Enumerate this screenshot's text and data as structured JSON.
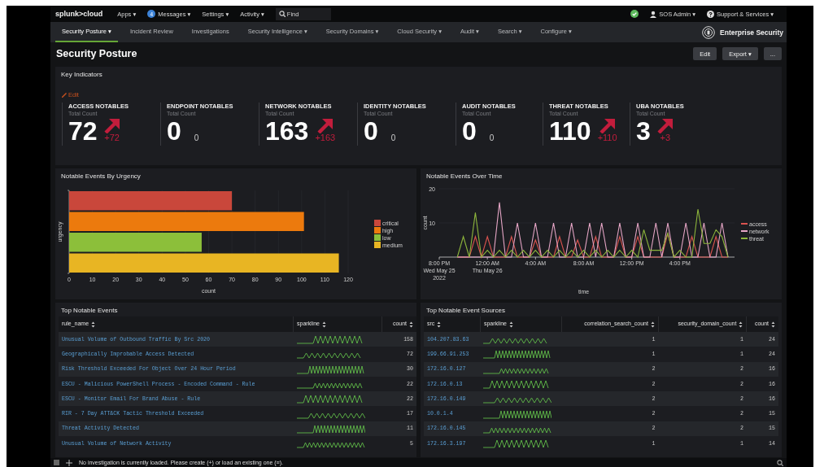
{
  "topbar": {
    "logo": "splunk>cloud",
    "menus": [
      {
        "label": "Apps ▾"
      },
      {
        "label": "Messages ▾",
        "badge": "4"
      },
      {
        "label": "Settings ▾"
      },
      {
        "label": "Activity ▾"
      }
    ],
    "search": {
      "placeholder": "Find"
    },
    "user": "SOS Admin ▾",
    "help": "Support & Services ▾"
  },
  "nav": {
    "tabs": [
      {
        "label": "Security Posture ▾",
        "selected": true
      },
      {
        "label": "Incident Review",
        "selected": false
      },
      {
        "label": "Investigations",
        "selected": false
      },
      {
        "label": "Security Intelligence ▾",
        "selected": false
      },
      {
        "label": "Security Domains ▾",
        "selected": false
      },
      {
        "label": "Cloud Security ▾",
        "selected": false
      },
      {
        "label": "Audit ▾",
        "selected": false
      },
      {
        "label": "Search ▾",
        "selected": false
      },
      {
        "label": "Configure ▾",
        "selected": false
      }
    ],
    "app_name": "Enterprise Security"
  },
  "page": {
    "title": "Security Posture",
    "buttons": [
      {
        "label": "Edit"
      },
      {
        "label": "Export ▾"
      },
      {
        "label": "..."
      }
    ]
  },
  "key_indicators": {
    "title": "Key Indicators",
    "edit_link": "Edit",
    "items": [
      {
        "label": "ACCESS NOTABLES",
        "sublabel": "Total Count",
        "value": "72",
        "delta": "+72",
        "rising": true
      },
      {
        "label": "ENDPOINT NOTABLES",
        "sublabel": "Total Count",
        "value": "0",
        "delta": "0",
        "rising": false
      },
      {
        "label": "NETWORK NOTABLES",
        "sublabel": "Total Count",
        "value": "163",
        "delta": "+163",
        "rising": true
      },
      {
        "label": "IDENTITY NOTABLES",
        "sublabel": "Total Count",
        "value": "0",
        "delta": "0",
        "rising": false
      },
      {
        "label": "AUDIT NOTABLES",
        "sublabel": "Total Count",
        "value": "0",
        "delta": "0",
        "rising": false
      },
      {
        "label": "THREAT NOTABLES",
        "sublabel": "Total Count",
        "value": "110",
        "delta": "+110",
        "rising": true
      },
      {
        "label": "UBA NOTABLES",
        "sublabel": "Total Count",
        "value": "3",
        "delta": "+3",
        "rising": true
      }
    ]
  },
  "urgency_panel": {
    "title": "Notable Events By Urgency",
    "chart_data": {
      "type": "bar",
      "orientation": "horizontal",
      "xlabel": "count",
      "ylabel": "urgency",
      "grid": true,
      "series": [
        {
          "name": "critical",
          "color": "#c9473b",
          "values": [
            70
          ]
        },
        {
          "name": "high",
          "color": "#ec7a0d",
          "values": [
            101
          ]
        },
        {
          "name": "low",
          "color": "#8cbf3a",
          "values": [
            57
          ]
        },
        {
          "name": "medium",
          "color": "#e8b523",
          "values": [
            116
          ]
        }
      ],
      "legend": true,
      "xlim": [
        0,
        120
      ],
      "xticks": [
        {
          "value": 0,
          "label": "0"
        },
        {
          "value": 10,
          "label": "10"
        },
        {
          "value": 20,
          "label": "20"
        },
        {
          "value": 30,
          "label": "30"
        },
        {
          "value": 40,
          "label": "40"
        },
        {
          "value": 50,
          "label": "50"
        },
        {
          "value": 60,
          "label": "60"
        },
        {
          "value": 70,
          "label": "70"
        },
        {
          "value": 80,
          "label": "80"
        },
        {
          "value": 90,
          "label": "90"
        },
        {
          "value": 100,
          "label": "100"
        },
        {
          "value": 110,
          "label": "110"
        },
        {
          "value": 120,
          "label": "120"
        }
      ]
    }
  },
  "time_panel": {
    "title": "Notable Events Over Time",
    "chart_data": {
      "type": "line",
      "xlabel": "time",
      "ylabel": "count",
      "categories": [
        "8:00 PM\nWed May 25\n2022",
        null,
        null,
        null,
        null,
        null,
        null,
        null,
        "12:00 AM\nThu May 26",
        null,
        null,
        null,
        null,
        null,
        null,
        null,
        "4:00 AM",
        null,
        null,
        null,
        null,
        null,
        null,
        null,
        "8:00 AM",
        null,
        null,
        null,
        null,
        null,
        null,
        null,
        "12:00 PM",
        null,
        null,
        null,
        null,
        null,
        null,
        null,
        "4:00 PM",
        null,
        null,
        null,
        null,
        null,
        null,
        null,
        null
      ],
      "series": [
        {
          "name": "access",
          "color": "#d9534f",
          "values": [
            null,
            null,
            null,
            0,
            0,
            0,
            6,
            0,
            6,
            0,
            0,
            0,
            6,
            0,
            0,
            0,
            5,
            0,
            0,
            0,
            6,
            0,
            0,
            5,
            0,
            0,
            6,
            0,
            0,
            0,
            6,
            0,
            0,
            6,
            0,
            0,
            0,
            0,
            7,
            0,
            0,
            0,
            6,
            0,
            0,
            0,
            6,
            0,
            0
          ]
        },
        {
          "name": "network",
          "color": "#e6a6c6",
          "values": [
            null,
            null,
            null,
            0,
            0,
            0,
            0,
            0,
            0,
            0,
            16,
            0,
            0,
            10,
            0,
            0,
            10,
            0,
            0,
            10,
            0,
            0,
            10,
            0,
            0,
            10,
            0,
            10,
            0,
            0,
            10,
            0,
            0,
            10,
            0,
            0,
            10,
            0,
            10,
            0,
            0,
            10,
            0,
            0,
            10,
            0,
            0,
            10,
            0
          ]
        },
        {
          "name": "threat",
          "color": "#8db53c",
          "values": [
            null,
            null,
            null,
            0,
            6,
            0,
            13,
            0,
            2,
            0,
            2,
            0,
            2,
            0,
            2,
            0,
            2,
            0,
            2,
            0,
            2,
            0,
            2,
            0,
            2,
            0,
            2,
            0,
            2,
            0,
            2,
            0,
            2,
            0,
            8,
            2,
            2,
            2,
            7,
            0,
            2,
            0,
            0,
            14,
            4,
            4,
            8,
            6,
            0
          ]
        }
      ],
      "legend": true,
      "ylim": [
        0,
        20
      ],
      "yticks": [
        {
          "value": 10,
          "label": "10"
        },
        {
          "value": 20,
          "label": "20"
        }
      ]
    }
  },
  "top_events": {
    "title": "Top Notable Events",
    "columns": [
      "rule_name",
      "sparkline",
      "count"
    ],
    "rows": [
      {
        "rule_name": "Unusual Volume of Outbound Traffic By Src 2020",
        "count": "158"
      },
      {
        "rule_name": "Geographically Improbable Access Detected",
        "count": "72"
      },
      {
        "rule_name": "Risk Threshold Exceeded For Object Over 24 Hour Period",
        "count": "30"
      },
      {
        "rule_name": "ESCU - Malicious PowerShell Process - Encoded Command - Rule",
        "count": "22"
      },
      {
        "rule_name": "ESCU - Monitor Email For Brand Abuse - Rule",
        "count": "22"
      },
      {
        "rule_name": "RIR - 7 Day ATT&CK Tactic Threshold Exceeded",
        "count": "17"
      },
      {
        "rule_name": "Threat Activity Detected",
        "count": "11"
      },
      {
        "rule_name": "Unusual Volume of Network Activity",
        "count": "5"
      }
    ]
  },
  "top_sources": {
    "title": "Top Notable Event Sources",
    "columns": [
      "src",
      "sparkline",
      "correlation_search_count",
      "security_domain_count",
      "count"
    ],
    "rows": [
      {
        "src": "104.207.83.63",
        "correlation_search_count": "1",
        "security_domain_count": "1",
        "count": "24"
      },
      {
        "src": "199.66.91.253",
        "correlation_search_count": "1",
        "security_domain_count": "1",
        "count": "24"
      },
      {
        "src": "172.16.0.127",
        "correlation_search_count": "2",
        "security_domain_count": "2",
        "count": "16"
      },
      {
        "src": "172.16.0.13",
        "correlation_search_count": "2",
        "security_domain_count": "2",
        "count": "16"
      },
      {
        "src": "172.16.0.149",
        "correlation_search_count": "2",
        "security_domain_count": "2",
        "count": "16"
      },
      {
        "src": "10.0.1.4",
        "correlation_search_count": "2",
        "security_domain_count": "2",
        "count": "15"
      },
      {
        "src": "172.16.0.145",
        "correlation_search_count": "2",
        "security_domain_count": "2",
        "count": "15"
      },
      {
        "src": "172.16.3.197",
        "correlation_search_count": "1",
        "security_domain_count": "1",
        "count": "14"
      }
    ]
  },
  "status_bar": {
    "message": "No investigation is currently loaded. Please create (+) or load an existing one (≡)."
  }
}
